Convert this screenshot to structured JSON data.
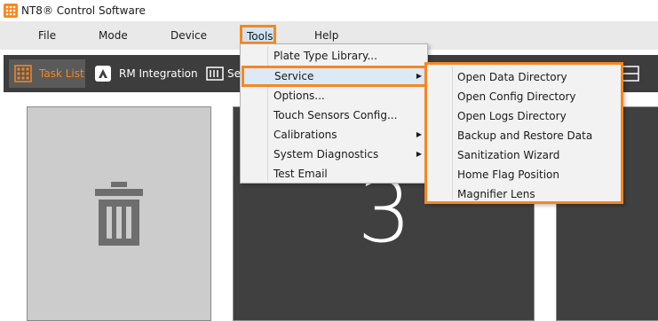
{
  "app": {
    "title": "NT8® Control Software"
  },
  "menubar": {
    "items": [
      "File",
      "Mode",
      "Device",
      "Tools",
      "Help"
    ],
    "active": "Tools"
  },
  "toolbar": {
    "buttons": [
      {
        "label": "Task List",
        "icon": "task-list-icon",
        "active": true
      },
      {
        "label": "RM Integration",
        "icon": "rm-integration-icon",
        "active": false
      },
      {
        "label": "Se",
        "icon": "sequence-icon",
        "active": false
      }
    ]
  },
  "tools_menu": {
    "items": [
      {
        "label": "Plate Type Library...",
        "submenu": false
      },
      {
        "label": "Service",
        "submenu": true,
        "highlighted": true
      },
      {
        "label": "Options...",
        "submenu": false
      },
      {
        "label": "Touch Sensors Config...",
        "submenu": false
      },
      {
        "label": "Calibrations",
        "submenu": true
      },
      {
        "label": "System Diagnostics",
        "submenu": true
      },
      {
        "label": "Test Email",
        "submenu": false
      }
    ]
  },
  "service_menu": {
    "items": [
      "Open Data Directory",
      "Open Config Directory",
      "Open Logs Directory",
      "Backup and Restore Data",
      "Sanitization Wizard",
      "Home Flag Position",
      "Magnifier Lens"
    ]
  },
  "tiles": {
    "trash_icon": "trash-icon",
    "number": "3"
  },
  "colors": {
    "accent": "#f7871f",
    "toolbar_bg": "#3d3d3d",
    "tile_dark": "#404040",
    "tile_light": "#cccccc"
  }
}
